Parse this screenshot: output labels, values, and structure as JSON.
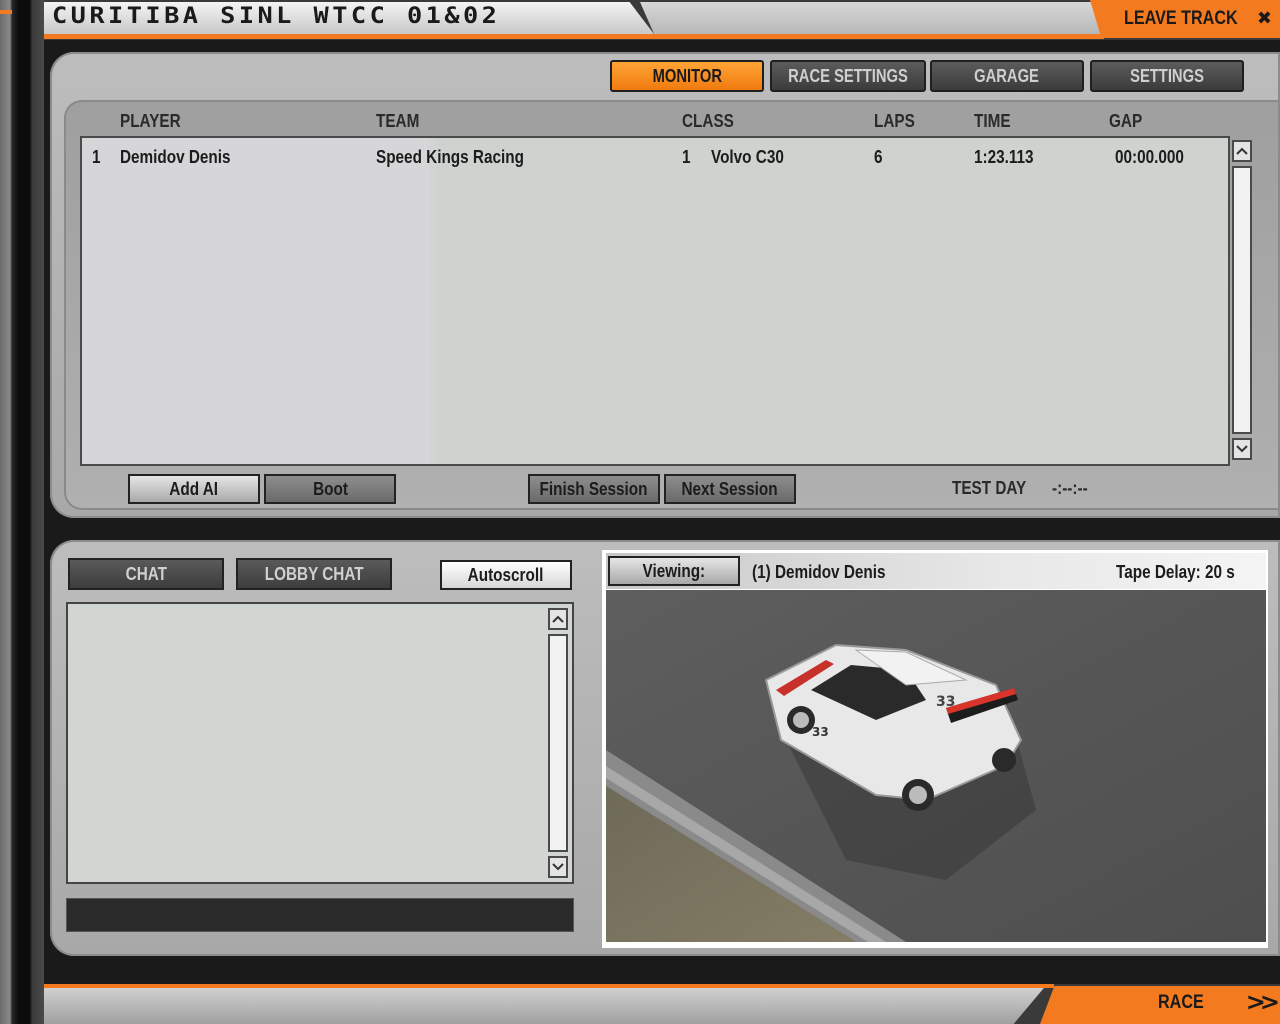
{
  "window": {
    "title": "CURITIBA SINL WTCC 01&02",
    "leave_label": "LEAVE TRACK",
    "close_glyph": "✖"
  },
  "tabs": [
    {
      "label": "MONITOR",
      "active": true
    },
    {
      "label": "RACE SETTINGS",
      "active": false
    },
    {
      "label": "GARAGE",
      "active": false
    },
    {
      "label": "SETTINGS",
      "active": false
    }
  ],
  "standings": {
    "columns": [
      "PLAYER",
      "TEAM",
      "CLASS",
      "LAPS",
      "TIME",
      "GAP"
    ],
    "rows": [
      {
        "pos": "1",
        "player": "Demidov Denis",
        "team": "Speed Kings Racing",
        "class_num": "1",
        "car": "Volvo C30",
        "laps": "6",
        "time": "1:23.113",
        "gap": "00:00.000"
      }
    ]
  },
  "session_buttons": {
    "add_ai": "Add AI",
    "boot": "Boot",
    "finish_session": "Finish Session",
    "next_session": "Next Session"
  },
  "session_status": {
    "label": "TEST DAY",
    "clock": "-:--:--"
  },
  "chat": {
    "chat_tab": "CHAT",
    "lobby_tab": "LOBBY CHAT",
    "autoscroll": "Autoscroll",
    "input_value": ""
  },
  "viewer": {
    "viewing_label": "Viewing:",
    "target": "(1) Demidov Denis",
    "tape_delay": "Tape Delay: 20 s",
    "car_number": "33"
  },
  "footer": {
    "race_label": "RACE"
  },
  "colors": {
    "accent": "#f47a1f",
    "panel": "#b5b5b5",
    "list_bg": "#d2d6d2"
  }
}
